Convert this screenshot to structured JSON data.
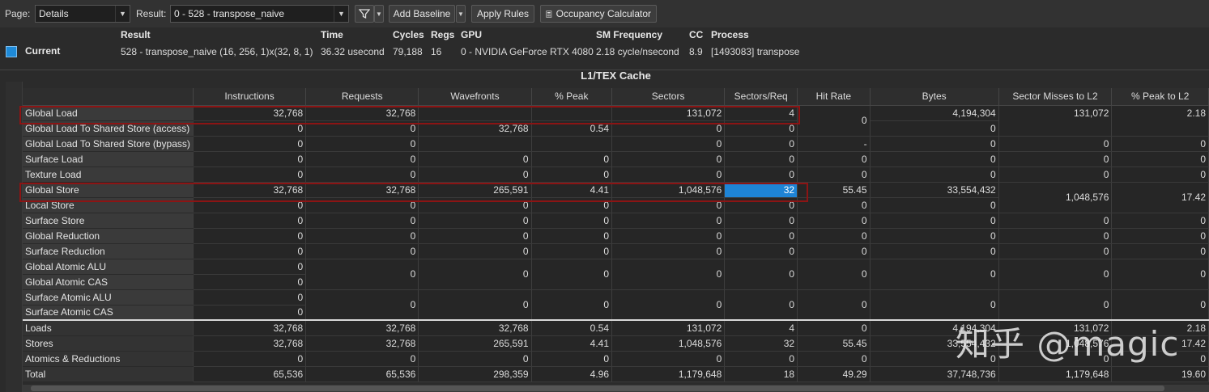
{
  "toolbar": {
    "page_label": "Page:",
    "page_value": "Details",
    "result_label": "Result:",
    "result_value": "0 -   528 - transpose_naive",
    "add_baseline": "Add Baseline",
    "apply_rules": "Apply Rules",
    "occupancy": "Occupancy Calculator"
  },
  "info": {
    "headers": [
      "Result",
      "Time",
      "Cycles",
      "Regs",
      "GPU",
      "SM Frequency",
      "CC",
      "Process"
    ],
    "current_label": "Current",
    "values": [
      "528 - transpose_naive (16, 256, 1)x(32, 8, 1)",
      "36.32 usecond",
      "79,188",
      "16",
      "0 - NVIDIA GeForce RTX 4080",
      "2.18 cycle/nsecond",
      "8.9",
      "[1493083] transpose"
    ],
    "swatch_color": "#1e8ad8"
  },
  "table": {
    "section_title": "L1/TEX Cache",
    "columns": [
      "",
      "Instructions",
      "Requests",
      "Wavefronts",
      "% Peak",
      "Sectors",
      "Sectors/Req",
      "Hit Rate",
      "Bytes",
      "Sector Misses to L2",
      "% Peak to L2"
    ],
    "rows": [
      {
        "label": "Global Load",
        "c": [
          "32,768",
          "32,768",
          "",
          "",
          "131,072",
          "4"
        ],
        "hit": "0",
        "bytes": "4,194,304",
        "miss": "131,072",
        "peakl2": "2.18"
      },
      {
        "label": "Global Load To Shared Store (access)",
        "c": [
          "0",
          "0",
          "32,768",
          "0.54",
          "0",
          "0"
        ],
        "bytes": "0"
      },
      {
        "label": "Global Load To Shared Store (bypass)",
        "c": [
          "0",
          "0",
          "",
          "",
          "0",
          "0"
        ],
        "hit": "-",
        "bytes": "0",
        "miss": "0",
        "peakl2": "0"
      },
      {
        "label": "Surface Load",
        "c": [
          "0",
          "0",
          "0",
          "0",
          "0",
          "0"
        ],
        "hit": "0",
        "bytes": "0",
        "miss": "0",
        "peakl2": "0"
      },
      {
        "label": "Texture Load",
        "c": [
          "0",
          "0",
          "0",
          "0",
          "0",
          "0"
        ],
        "hit": "0",
        "bytes": "0",
        "miss": "0",
        "peakl2": "0"
      },
      {
        "label": "Global Store",
        "c": [
          "32,768",
          "32,768",
          "265,591",
          "4.41",
          "1,048,576",
          "32"
        ],
        "hit": "55.45",
        "bytes": "33,554,432",
        "miss": "1,048,576",
        "peakl2": "17.42"
      },
      {
        "label": "Local Store",
        "c": [
          "0",
          "0",
          "0",
          "0",
          "0",
          "0"
        ],
        "hit": "0",
        "bytes": "0"
      },
      {
        "label": "Surface Store",
        "c": [
          "0",
          "0",
          "0",
          "0",
          "0",
          "0"
        ],
        "hit": "0",
        "bytes": "0",
        "miss": "0",
        "peakl2": "0"
      },
      {
        "label": "Global Reduction",
        "c": [
          "0",
          "0",
          "0",
          "0",
          "0",
          "0"
        ],
        "hit": "0",
        "bytes": "0",
        "miss": "0",
        "peakl2": "0"
      },
      {
        "label": "Surface Reduction",
        "c": [
          "0",
          "0",
          "0",
          "0",
          "0",
          "0"
        ],
        "hit": "0",
        "bytes": "0",
        "miss": "0",
        "peakl2": "0"
      },
      {
        "label": "Global Atomic ALU",
        "c": [
          "0"
        ],
        "wav": "0",
        "peak": "0",
        "sec": "0",
        "spr": "0",
        "hit": "0",
        "bytes": "0",
        "miss": "0",
        "peakl2": "0"
      },
      {
        "label": "Global Atomic CAS",
        "c": [
          "0"
        ]
      },
      {
        "label": "Surface Atomic ALU",
        "c": [
          "0"
        ],
        "wav": "0",
        "peak": "0",
        "sec": "0",
        "spr": "0",
        "hit": "0",
        "bytes": "0",
        "miss": "0",
        "peakl2": "0"
      },
      {
        "label": "Surface Atomic CAS",
        "c": [
          "0"
        ]
      },
      {
        "label": "Loads",
        "c": [
          "32,768",
          "32,768",
          "32,768",
          "0.54",
          "131,072",
          "4"
        ],
        "hit": "0",
        "bytes": "4,194,304",
        "miss": "131,072",
        "peakl2": "2.18"
      },
      {
        "label": "Stores",
        "c": [
          "32,768",
          "32,768",
          "265,591",
          "4.41",
          "1,048,576",
          "32"
        ],
        "hit": "55.45",
        "bytes": "33,554,432",
        "miss": "1,048,576",
        "peakl2": "17.42"
      },
      {
        "label": "Atomics & Reductions",
        "c": [
          "0",
          "0",
          "0",
          "0",
          "0",
          "0"
        ],
        "hit": "0",
        "bytes": "0",
        "miss": "0",
        "peakl2": "0"
      },
      {
        "label": "Total",
        "c": [
          "65,536",
          "65,536",
          "298,359",
          "4.96",
          "1,179,648",
          "18"
        ],
        "hit": "49.29",
        "bytes": "37,748,736",
        "miss": "1,179,648",
        "peakl2": "19.60"
      }
    ]
  },
  "watermark": "知乎 @magic"
}
